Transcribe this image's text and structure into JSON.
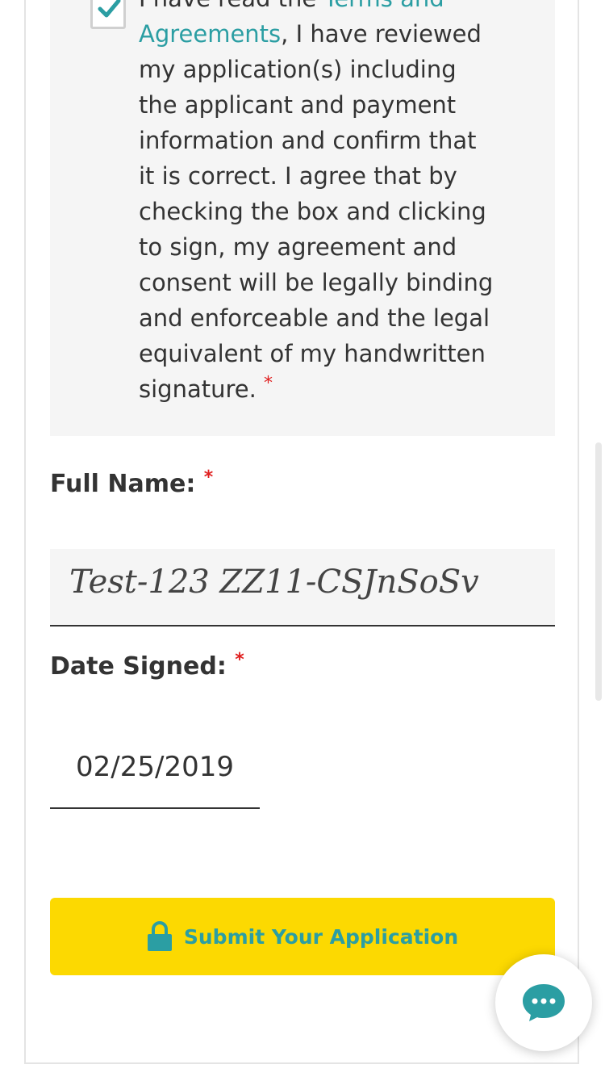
{
  "agreement": {
    "text_prefix": "I have read the ",
    "link_text": "Terms and Agreements",
    "text_suffix": ", I have reviewed my application(s) including the applicant and payment information and confirm that it is correct. I agree that by checking the box and clicking to sign, my agreement and consent will be legally binding and enforceable and the legal equivalent of my handwritten signature.",
    "checked": true,
    "required_marker": "*"
  },
  "full_name": {
    "label": "Full Name:",
    "required_marker": "*",
    "value": "Test-123 ZZ11-CSJnSoSv"
  },
  "date_signed": {
    "label": "Date Signed:",
    "required_marker": "*",
    "value": "02/25/2019"
  },
  "submit": {
    "label": "Submit Your Application",
    "icon": "lock-icon"
  },
  "chat": {
    "icon": "chat-bubble-icon"
  },
  "colors": {
    "accent": "#2b9ea3",
    "button_bg": "#fcd901",
    "required": "#e02020",
    "panel_bg": "#f5f5f5"
  }
}
